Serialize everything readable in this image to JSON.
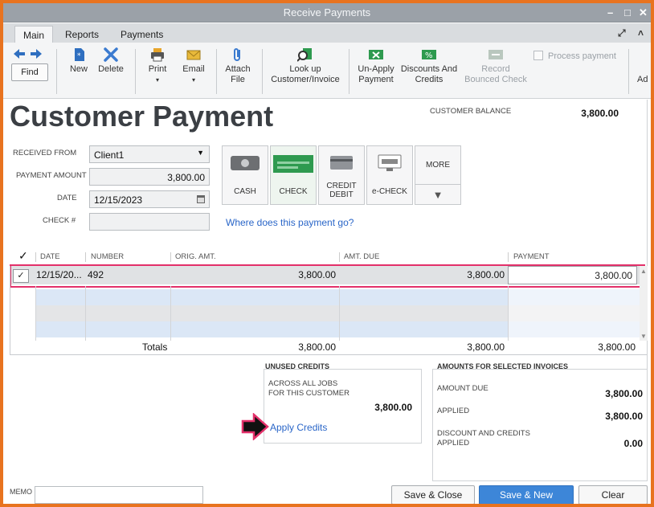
{
  "window": {
    "title": "Receive Payments"
  },
  "ribbon_tabs": [
    "Main",
    "Reports",
    "Payments"
  ],
  "toolbar": {
    "find": "Find",
    "new": "New",
    "delete": "Delete",
    "print": "Print",
    "email": "Email",
    "attach": [
      "Attach",
      "File"
    ],
    "lookup": [
      "Look up",
      "Customer/Invoice"
    ],
    "unapply": [
      "Un-Apply",
      "Payment"
    ],
    "discounts": [
      "Discounts And",
      "Credits"
    ],
    "record_bounced": [
      "Record",
      "Bounced Check"
    ],
    "process_payment": "Process payment",
    "cut_label": "Ad"
  },
  "form": {
    "heading": "Customer Payment",
    "customer_balance_label": "CUSTOMER BALANCE",
    "customer_balance": "3,800.00",
    "received_from_label": "RECEIVED FROM",
    "received_from": "Client1",
    "payment_amount_label": "PAYMENT AMOUNT",
    "payment_amount": "3,800.00",
    "date_label": "DATE",
    "date": "12/15/2023",
    "check_no_label": "CHECK #",
    "check_no": ""
  },
  "payment_methods": {
    "cash": "CASH",
    "check": "CHECK",
    "credit": [
      "CREDIT",
      "DEBIT"
    ],
    "echeck": "e-CHECK",
    "more": "MORE"
  },
  "where_link": "Where does this payment go?",
  "grid": {
    "check_header": "✓",
    "headers": [
      "DATE",
      "NUMBER",
      "ORIG. AMT.",
      "AMT. DUE",
      "PAYMENT"
    ],
    "row": {
      "checked": "✓",
      "date": "12/15/20...",
      "number": "492",
      "orig_amt": "3,800.00",
      "amt_due": "3,800.00",
      "payment": "3,800.00"
    },
    "totals": {
      "label": "Totals",
      "orig_amt": "3,800.00",
      "amt_due": "3,800.00",
      "payment": "3,800.00"
    }
  },
  "unused_credits": {
    "title": "UNUSED CREDITS",
    "desc_line1": "ACROSS ALL JOBS",
    "desc_line2": "FOR THIS CUSTOMER",
    "amount": "3,800.00",
    "apply_link": "Apply Credits"
  },
  "amounts_selected": {
    "title": "AMOUNTS FOR SELECTED INVOICES",
    "amount_due_label": "AMOUNT DUE",
    "amount_due": "3,800.00",
    "applied_label": "APPLIED",
    "applied": "3,800.00",
    "discount_line1": "DISCOUNT AND CREDITS",
    "discount_line2": "APPLIED",
    "discount": "0.00"
  },
  "memo_label": "MEMO",
  "buttons": {
    "save_close": "Save & Close",
    "save_new": "Save & New",
    "clear": "Clear"
  },
  "colors": {
    "frame": "#e8731f",
    "highlight": "#e3306a",
    "link": "#2a66c8",
    "primary_button": "#3d86d8"
  }
}
